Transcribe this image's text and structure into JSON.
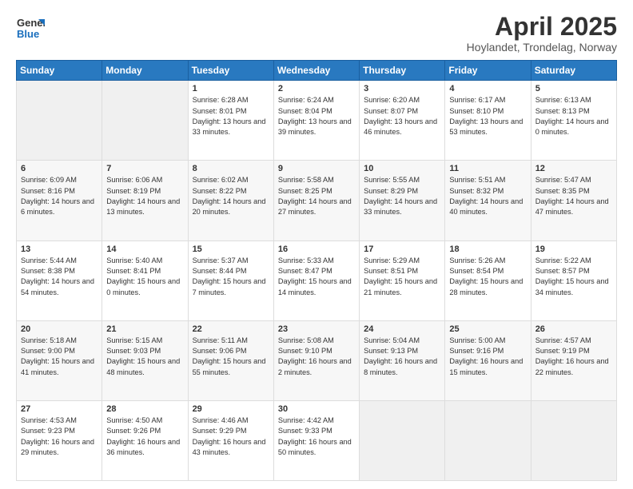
{
  "logo": {
    "line1": "General",
    "line2": "Blue"
  },
  "title": "April 2025",
  "subtitle": "Hoylandet, Trondelag, Norway",
  "days": [
    "Sunday",
    "Monday",
    "Tuesday",
    "Wednesday",
    "Thursday",
    "Friday",
    "Saturday"
  ],
  "weeks": [
    [
      {
        "day": "",
        "info": ""
      },
      {
        "day": "",
        "info": ""
      },
      {
        "day": "1",
        "info": "Sunrise: 6:28 AM\nSunset: 8:01 PM\nDaylight: 13 hours and 33 minutes."
      },
      {
        "day": "2",
        "info": "Sunrise: 6:24 AM\nSunset: 8:04 PM\nDaylight: 13 hours and 39 minutes."
      },
      {
        "day": "3",
        "info": "Sunrise: 6:20 AM\nSunset: 8:07 PM\nDaylight: 13 hours and 46 minutes."
      },
      {
        "day": "4",
        "info": "Sunrise: 6:17 AM\nSunset: 8:10 PM\nDaylight: 13 hours and 53 minutes."
      },
      {
        "day": "5",
        "info": "Sunrise: 6:13 AM\nSunset: 8:13 PM\nDaylight: 14 hours and 0 minutes."
      }
    ],
    [
      {
        "day": "6",
        "info": "Sunrise: 6:09 AM\nSunset: 8:16 PM\nDaylight: 14 hours and 6 minutes."
      },
      {
        "day": "7",
        "info": "Sunrise: 6:06 AM\nSunset: 8:19 PM\nDaylight: 14 hours and 13 minutes."
      },
      {
        "day": "8",
        "info": "Sunrise: 6:02 AM\nSunset: 8:22 PM\nDaylight: 14 hours and 20 minutes."
      },
      {
        "day": "9",
        "info": "Sunrise: 5:58 AM\nSunset: 8:25 PM\nDaylight: 14 hours and 27 minutes."
      },
      {
        "day": "10",
        "info": "Sunrise: 5:55 AM\nSunset: 8:29 PM\nDaylight: 14 hours and 33 minutes."
      },
      {
        "day": "11",
        "info": "Sunrise: 5:51 AM\nSunset: 8:32 PM\nDaylight: 14 hours and 40 minutes."
      },
      {
        "day": "12",
        "info": "Sunrise: 5:47 AM\nSunset: 8:35 PM\nDaylight: 14 hours and 47 minutes."
      }
    ],
    [
      {
        "day": "13",
        "info": "Sunrise: 5:44 AM\nSunset: 8:38 PM\nDaylight: 14 hours and 54 minutes."
      },
      {
        "day": "14",
        "info": "Sunrise: 5:40 AM\nSunset: 8:41 PM\nDaylight: 15 hours and 0 minutes."
      },
      {
        "day": "15",
        "info": "Sunrise: 5:37 AM\nSunset: 8:44 PM\nDaylight: 15 hours and 7 minutes."
      },
      {
        "day": "16",
        "info": "Sunrise: 5:33 AM\nSunset: 8:47 PM\nDaylight: 15 hours and 14 minutes."
      },
      {
        "day": "17",
        "info": "Sunrise: 5:29 AM\nSunset: 8:51 PM\nDaylight: 15 hours and 21 minutes."
      },
      {
        "day": "18",
        "info": "Sunrise: 5:26 AM\nSunset: 8:54 PM\nDaylight: 15 hours and 28 minutes."
      },
      {
        "day": "19",
        "info": "Sunrise: 5:22 AM\nSunset: 8:57 PM\nDaylight: 15 hours and 34 minutes."
      }
    ],
    [
      {
        "day": "20",
        "info": "Sunrise: 5:18 AM\nSunset: 9:00 PM\nDaylight: 15 hours and 41 minutes."
      },
      {
        "day": "21",
        "info": "Sunrise: 5:15 AM\nSunset: 9:03 PM\nDaylight: 15 hours and 48 minutes."
      },
      {
        "day": "22",
        "info": "Sunrise: 5:11 AM\nSunset: 9:06 PM\nDaylight: 15 hours and 55 minutes."
      },
      {
        "day": "23",
        "info": "Sunrise: 5:08 AM\nSunset: 9:10 PM\nDaylight: 16 hours and 2 minutes."
      },
      {
        "day": "24",
        "info": "Sunrise: 5:04 AM\nSunset: 9:13 PM\nDaylight: 16 hours and 8 minutes."
      },
      {
        "day": "25",
        "info": "Sunrise: 5:00 AM\nSunset: 9:16 PM\nDaylight: 16 hours and 15 minutes."
      },
      {
        "day": "26",
        "info": "Sunrise: 4:57 AM\nSunset: 9:19 PM\nDaylight: 16 hours and 22 minutes."
      }
    ],
    [
      {
        "day": "27",
        "info": "Sunrise: 4:53 AM\nSunset: 9:23 PM\nDaylight: 16 hours and 29 minutes."
      },
      {
        "day": "28",
        "info": "Sunrise: 4:50 AM\nSunset: 9:26 PM\nDaylight: 16 hours and 36 minutes."
      },
      {
        "day": "29",
        "info": "Sunrise: 4:46 AM\nSunset: 9:29 PM\nDaylight: 16 hours and 43 minutes."
      },
      {
        "day": "30",
        "info": "Sunrise: 4:42 AM\nSunset: 9:33 PM\nDaylight: 16 hours and 50 minutes."
      },
      {
        "day": "",
        "info": ""
      },
      {
        "day": "",
        "info": ""
      },
      {
        "day": "",
        "info": ""
      }
    ]
  ]
}
